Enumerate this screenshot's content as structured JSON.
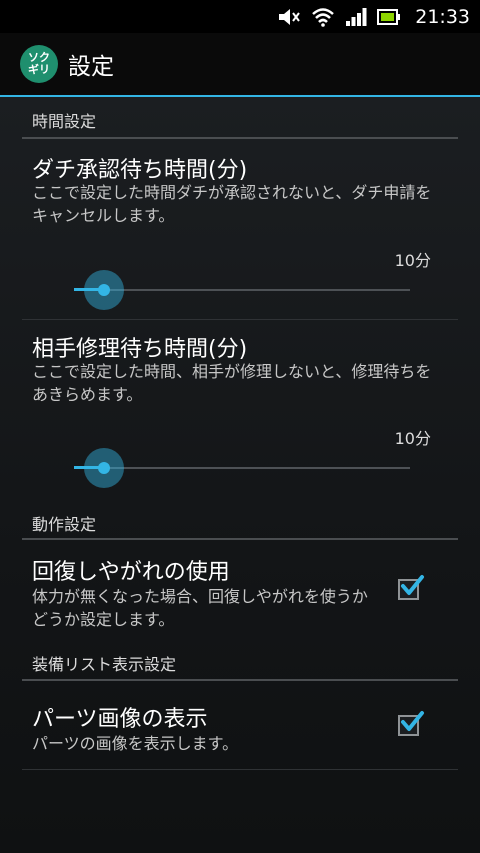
{
  "status_bar": {
    "time": "21:33"
  },
  "action_bar": {
    "icon_text_top": "ソク",
    "icon_text_bottom": "ギリ",
    "title": "設定"
  },
  "sections": {
    "time": {
      "header": "時間設定",
      "approval": {
        "title": "ダチ承認待ち時間(分)",
        "summary": "ここで設定した時間ダチが承認されないと、ダチ申請をキャンセルします。",
        "value_label": "10分",
        "value": 10
      },
      "repair": {
        "title": "相手修理待ち時間(分)",
        "summary": "ここで設定した時間、相手が修理しないと、修理待ちをあきらめます。",
        "value_label": "10分",
        "value": 10
      }
    },
    "behavior": {
      "header": "動作設定",
      "recovery": {
        "title": "回復しやがれの使用",
        "summary": "体力が無くなった場合、回復しやがれを使うかどうか設定します。",
        "checked": true
      }
    },
    "equipment": {
      "header": "装備リスト表示設定",
      "parts_image": {
        "title": "パーツ画像の表示",
        "summary": "パーツの画像を表示します。",
        "checked": true
      }
    }
  },
  "colors": {
    "accent": "#33b5e5",
    "app_icon": "#1f8f6e"
  }
}
